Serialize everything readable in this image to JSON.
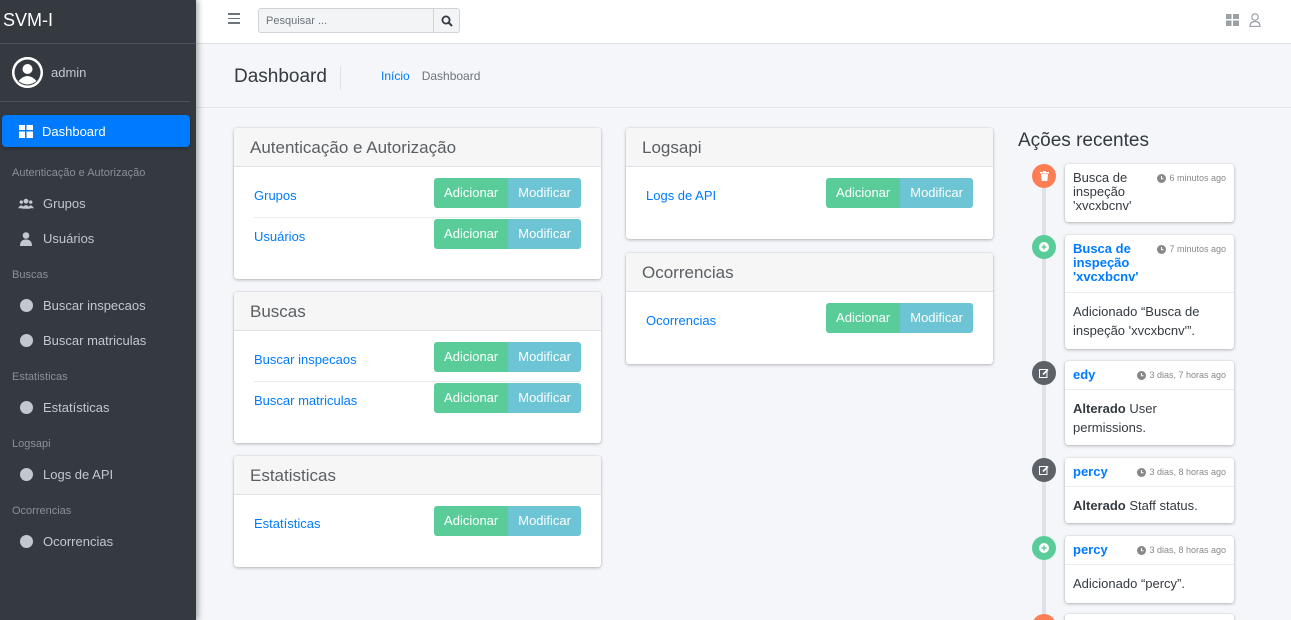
{
  "app": {
    "title": "SVM-I"
  },
  "user": {
    "name": "admin"
  },
  "sidebar": {
    "active": "Dashboard",
    "groups": [
      {
        "header": "Autenticação e Autorização",
        "items": [
          "Grupos",
          "Usuários"
        ]
      },
      {
        "header": "Buscas",
        "items": [
          "Buscar inspecaos",
          "Buscar matriculas"
        ]
      },
      {
        "header": "Estatisticas",
        "items": [
          "Estatísticas"
        ]
      },
      {
        "header": "Logsapi",
        "items": [
          "Logs de API"
        ]
      },
      {
        "header": "Ocorrencias",
        "items": [
          "Ocorrencias"
        ]
      }
    ]
  },
  "search": {
    "placeholder": "Pesquisar ..."
  },
  "header": {
    "title": "Dashboard",
    "breadcrumb_home": "Início",
    "breadcrumb_current": "Dashboard"
  },
  "buttons": {
    "add": "Adicionar",
    "modify": "Modificar"
  },
  "cards": [
    {
      "title": "Autenticação e Autorização",
      "rows": [
        "Grupos",
        "Usuários"
      ]
    },
    {
      "title": "Buscas",
      "rows": [
        "Buscar inspecaos",
        "Buscar matriculas"
      ]
    },
    {
      "title": "Estatisticas",
      "rows": [
        "Estatísticas"
      ]
    },
    {
      "title": "Logsapi",
      "rows": [
        "Logs de API"
      ]
    },
    {
      "title": "Ocorrencias",
      "rows": [
        "Ocorrencias"
      ]
    }
  ],
  "recent": {
    "title": "Ações recentes",
    "items": [
      {
        "type": "delete",
        "color": "#fd7e55",
        "who": "Busca de inspeção 'xvcxbcnv'",
        "time": "6 minutos ago"
      },
      {
        "type": "add",
        "color": "#5acc9a",
        "who": "Busca de inspeção 'xvcxbcnv'",
        "time": "7 minutos ago",
        "text": "Adicionado “Busca de inspeção 'xvcxbcnv'”."
      },
      {
        "type": "edit",
        "color": "#5c6268",
        "who": "edy",
        "time": "3 dias, 7 horas ago",
        "bold": "Alterado",
        "text": " User permissions."
      },
      {
        "type": "edit",
        "color": "#5c6268",
        "who": "percy",
        "time": "3 dias, 8 horas ago",
        "bold": "Alterado",
        "text": " Staff status."
      },
      {
        "type": "add",
        "color": "#5acc9a",
        "who": "percy",
        "time": "3 dias, 8 horas ago",
        "text": "Adicionado “percy”."
      }
    ]
  }
}
